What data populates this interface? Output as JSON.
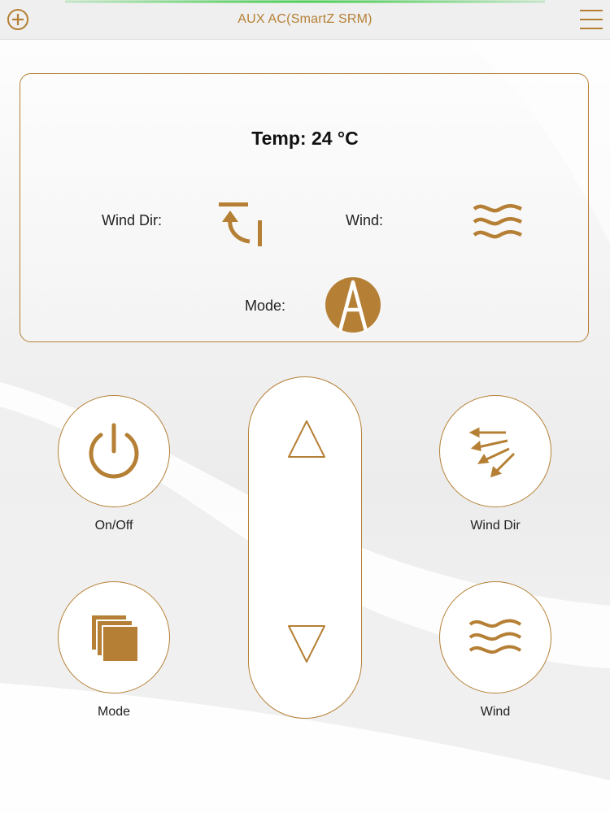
{
  "header": {
    "title": "AUX AC(SmartZ SRM)",
    "add_icon": "plus-circle-icon",
    "menu_icon": "hamburger-menu-icon"
  },
  "status": {
    "temp_text": "Temp: 24 °C",
    "wind_dir_label": "Wind Dir:",
    "wind_label": "Wind:",
    "mode_label": "Mode:",
    "wind_dir_icon": "swing-direction-icon",
    "wind_icon": "wind-waves-icon",
    "mode_icon": "auto-mode-icon",
    "mode_glyph": "A"
  },
  "controls": {
    "onoff_label": "On/Off",
    "wind_dir_label": "Wind Dir",
    "mode_label": "Mode",
    "wind_label": "Wind",
    "temp_up_icon": "triangle-up-icon",
    "temp_down_icon": "triangle-down-icon"
  },
  "colors": {
    "accent": "#b58035",
    "top_glow": "#2ec63a",
    "text": "#222222"
  }
}
